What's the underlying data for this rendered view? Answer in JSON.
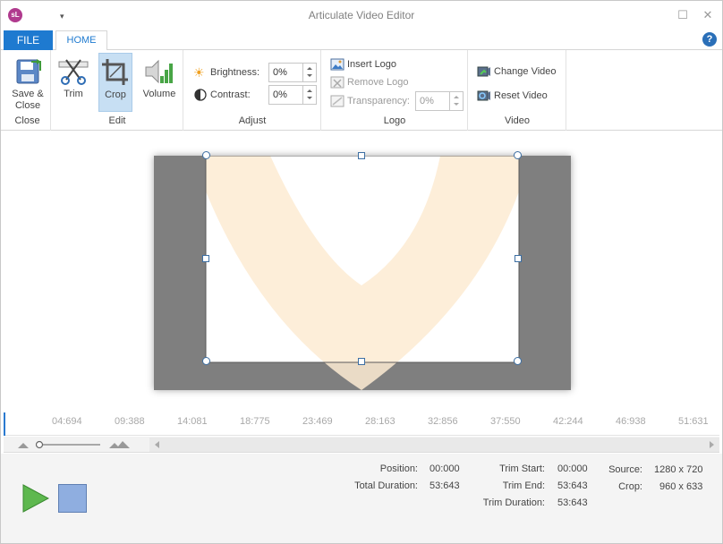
{
  "app": {
    "title": "Articulate Video Editor",
    "icon_text": "sL",
    "help_label": "?"
  },
  "tabs": {
    "file": "FILE",
    "home": "HOME"
  },
  "ribbon": {
    "close_group": {
      "label": "Close",
      "save_close": "Save &\nClose",
      "save_line1": "Save &",
      "save_line2": "Close"
    },
    "edit_group": {
      "label": "Edit",
      "trim": "Trim",
      "crop": "Crop",
      "volume": "Volume"
    },
    "adjust_group": {
      "label": "Adjust",
      "brightness_label": "Brightness:",
      "brightness_value": "0%",
      "contrast_label": "Contrast:",
      "contrast_value": "0%"
    },
    "logo_group": {
      "label": "Logo",
      "insert_logo": "Insert Logo",
      "remove_logo": "Remove Logo",
      "transparency_label": "Transparency:",
      "transparency_value": "0%"
    },
    "video_group": {
      "label": "Video",
      "change_video": "Change Video",
      "reset_video": "Reset Video"
    }
  },
  "timeline": {
    "ticks": [
      "04:694",
      "09:388",
      "14:081",
      "18:775",
      "23:469",
      "28:163",
      "32:856",
      "37:550",
      "42:244",
      "46:938",
      "51:631"
    ]
  },
  "status": {
    "position_label": "Position:",
    "position_value": "00:000",
    "total_duration_label": "Total Duration:",
    "total_duration_value": "53:643",
    "trim_start_label": "Trim Start:",
    "trim_start_value": "00:000",
    "trim_end_label": "Trim End:",
    "trim_end_value": "53:643",
    "trim_duration_label": "Trim Duration:",
    "trim_duration_value": "53:643",
    "source_label": "Source:",
    "source_value": "1280 x 720",
    "crop_label": "Crop:",
    "crop_value": "960 x 633"
  },
  "colors": {
    "accent": "#1e7ad0",
    "crop_selected": "#c7dff3",
    "video_gray": "#7f7f7f",
    "logo_tint": "#fdebd2"
  }
}
